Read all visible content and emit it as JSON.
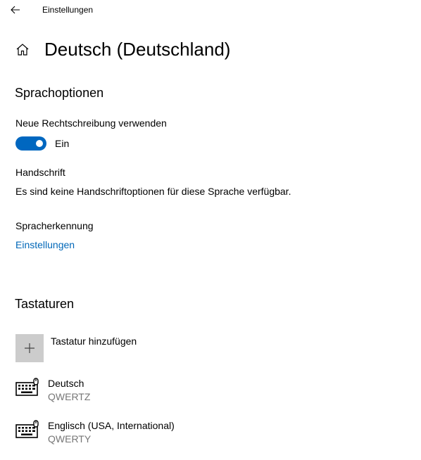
{
  "titlebar": {
    "back_icon": "arrow-left-icon",
    "app_title": "Einstellungen"
  },
  "header": {
    "home_icon": "home-icon",
    "title": "Deutsch (Deutschland)"
  },
  "language_options": {
    "section_title": "Sprachoptionen",
    "spellcheck_label": "Neue Rechtschreibung verwenden",
    "spellcheck_toggle": {
      "state": "on",
      "state_label": "Ein",
      "color": "#0067c0"
    },
    "handwriting_title": "Handschrift",
    "handwriting_text": "Es sind keine Handschriftoptionen für diese Sprache verfügbar.",
    "speech_title": "Spracherkennung",
    "speech_link": "Einstellungen",
    "link_color": "#0067b8"
  },
  "keyboards": {
    "section_title": "Tastaturen",
    "add_label": "Tastatur hinzufügen",
    "add_icon": "plus-icon",
    "items": [
      {
        "name": "Deutsch",
        "layout": "QWERTZ",
        "icon": "keyboard-icon"
      },
      {
        "name": "Englisch (USA, International)",
        "layout": "QWERTY",
        "icon": "keyboard-icon"
      }
    ]
  }
}
